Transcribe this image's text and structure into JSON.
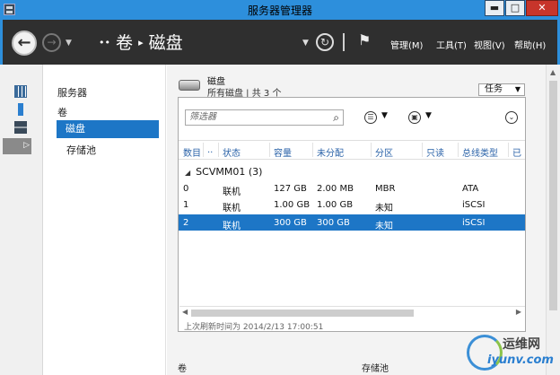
{
  "window": {
    "title": "服务器管理器",
    "controls": {
      "minimize": "▬",
      "maximize": "□",
      "close": "✕"
    }
  },
  "command_bar": {
    "breadcrumb": [
      "卷",
      "磁盘"
    ],
    "breadcrumb_prefix": "••",
    "menus": [
      "管理(M)",
      "工具(T)",
      "视图(V)",
      "帮助(H)"
    ]
  },
  "icon_strip": [
    "dashboard-icon",
    "local-server-icon",
    "all-servers-icon",
    "file-storage-icon"
  ],
  "nav_pane": {
    "items": [
      "服务器",
      "卷",
      "磁盘",
      "存储池"
    ],
    "selected": "磁盘"
  },
  "section": {
    "title": "磁盘",
    "subtitle": "所有磁盘 | 共 3 个",
    "tasks_label": "任务"
  },
  "filter": {
    "placeholder": "筛选器"
  },
  "table": {
    "columns": [
      "数目",
      "..",
      "状态",
      "容量",
      "未分配",
      "分区",
      "只读",
      "总线类型",
      "已"
    ],
    "group": "SCVMM01 (3)",
    "rows": [
      {
        "num": "0",
        "status": "联机",
        "capacity": "127 GB",
        "unallocated": "2.00 MB",
        "partition": "MBR",
        "readonly": "",
        "bus": "ATA"
      },
      {
        "num": "1",
        "status": "联机",
        "capacity": "1.00 GB",
        "unallocated": "1.00 GB",
        "partition": "未知",
        "readonly": "",
        "bus": "iSCSI"
      },
      {
        "num": "2",
        "status": "联机",
        "capacity": "300 GB",
        "unallocated": "300 GB",
        "partition": "未知",
        "readonly": "",
        "bus": "iSCSI"
      }
    ],
    "selected_row": 2
  },
  "status_text": "上次刷新时间为 2014/2/13 17:00:51",
  "lower_sections": [
    "卷",
    "存储池"
  ],
  "watermark": {
    "cn": "运维网",
    "en": "iyunv.com"
  },
  "colors": {
    "titlebar": "#2d8fdc",
    "command_bar": "#2f2f2f",
    "selection": "#1d76c6"
  }
}
